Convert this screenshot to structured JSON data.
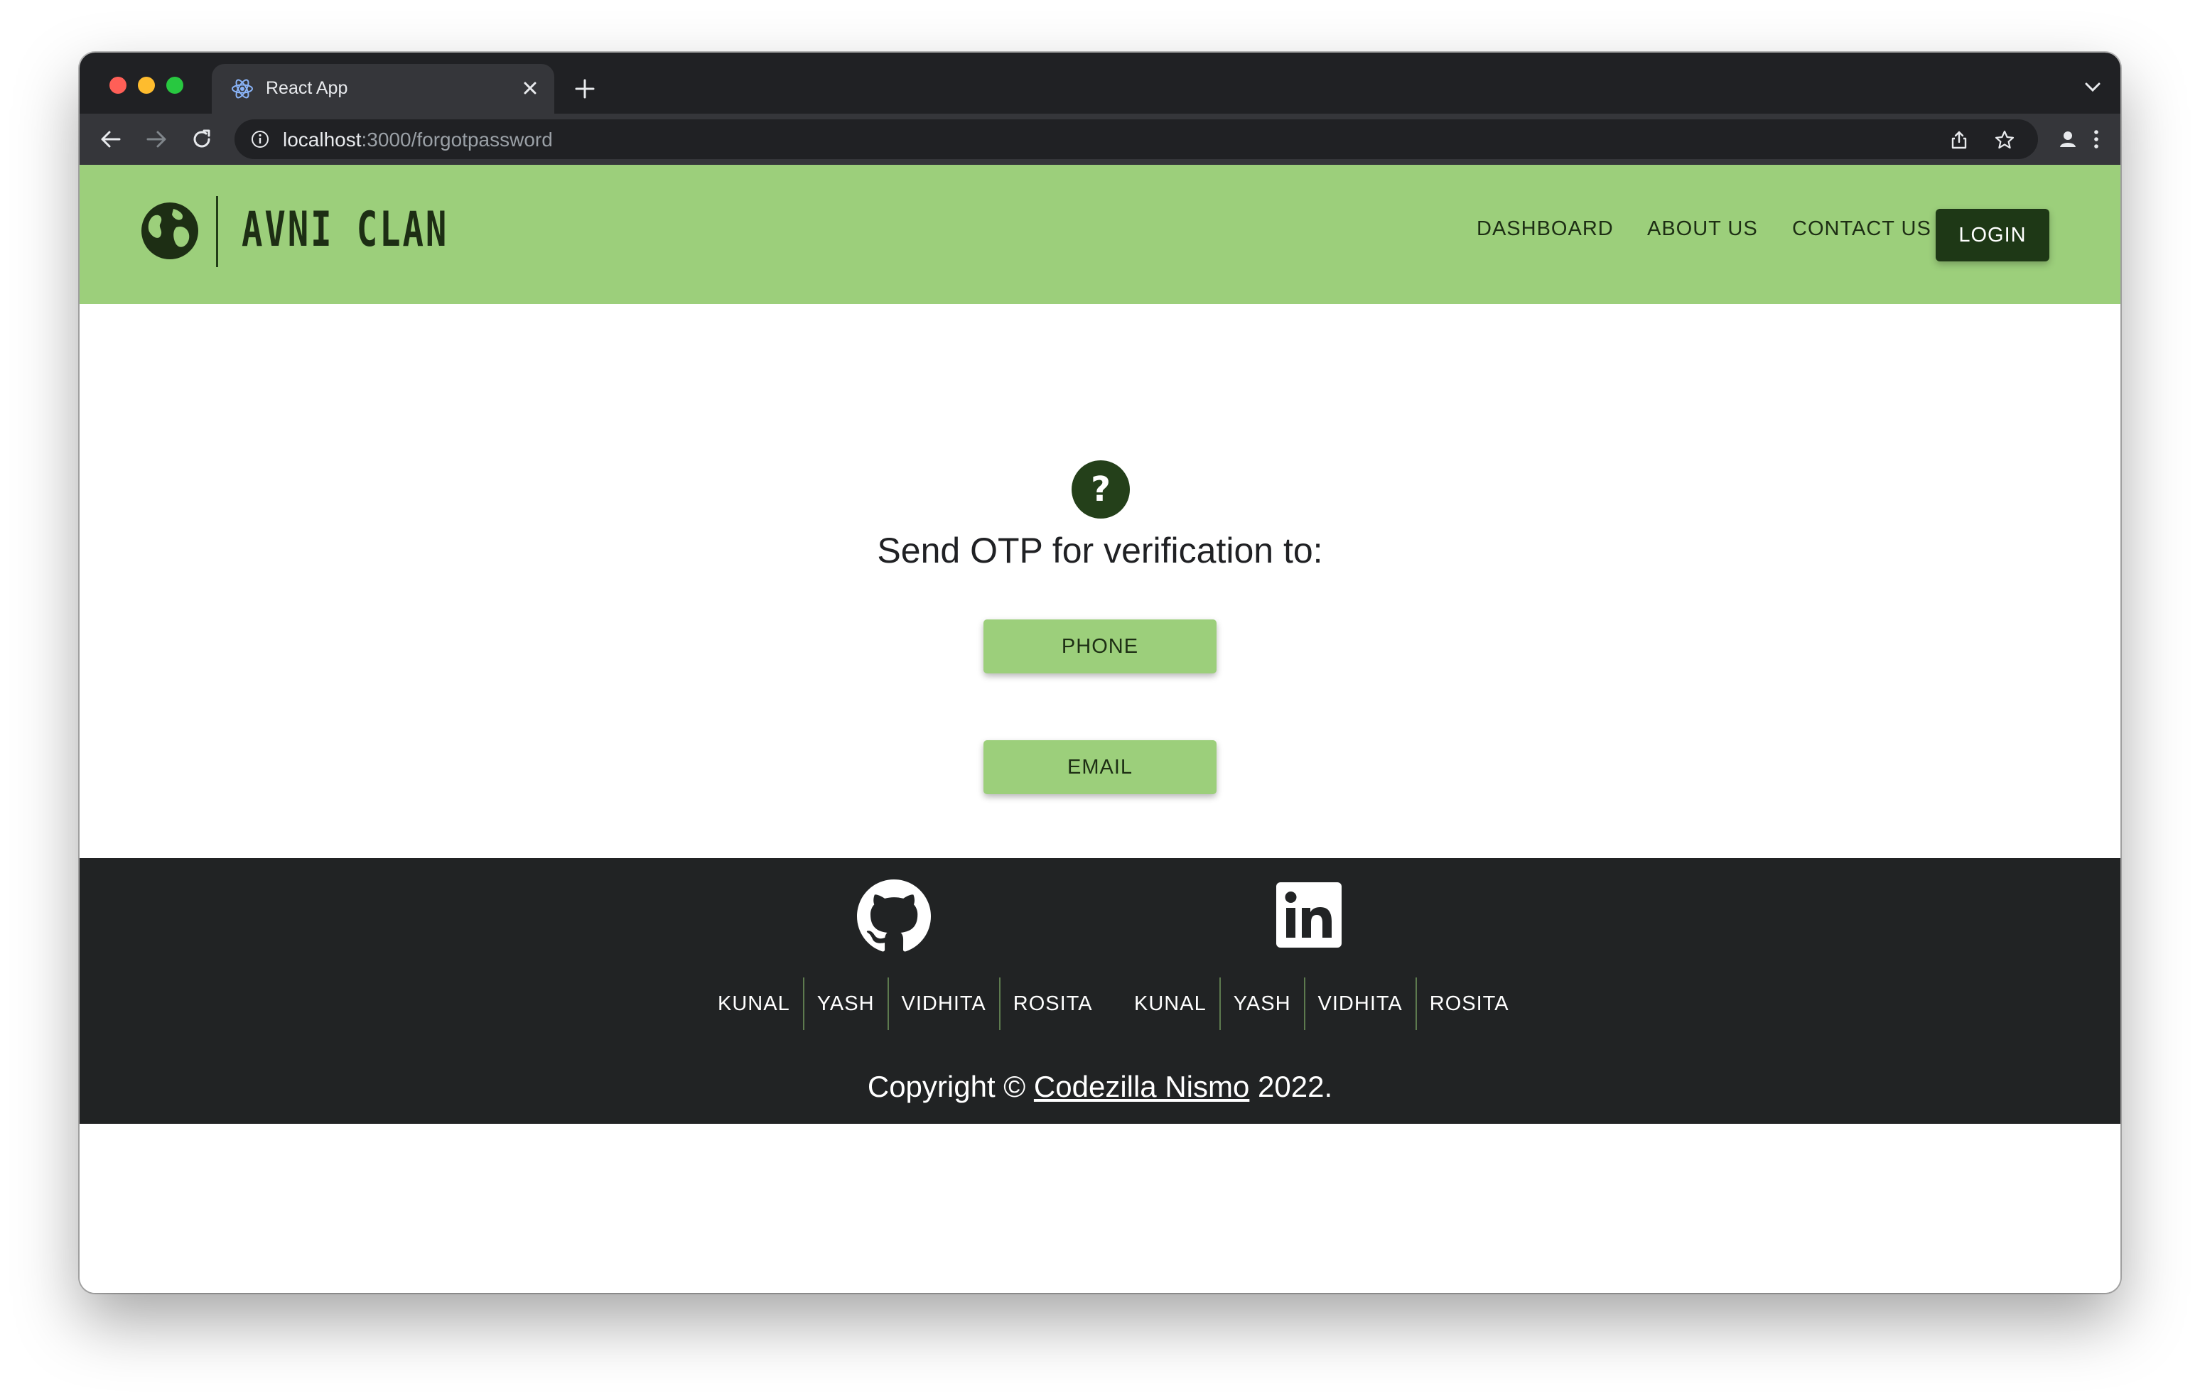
{
  "browser": {
    "tab_title": "React App",
    "url_host": "localhost",
    "url_path": ":3000/forgotpassword"
  },
  "site": {
    "brand": "AVNI CLAN",
    "nav": {
      "dashboard": "DASHBOARD",
      "about": "ABOUT US",
      "contact": "CONTACT US",
      "login": "LOGIN"
    }
  },
  "main": {
    "help_symbol": "?",
    "heading": "Send OTP for verification to:",
    "phone_label": "PHONE",
    "email_label": "EMAIL"
  },
  "footer": {
    "github_members": [
      "KUNAL",
      "YASH",
      "VIDHITA",
      "ROSITA"
    ],
    "linkedin_members": [
      "KUNAL",
      "YASH",
      "VIDHITA",
      "ROSITA"
    ],
    "copyright_prefix": "Copyright ©",
    "copyright_link": "Codezilla Nismo",
    "copyright_suffix": "2022."
  },
  "icons": {
    "tab_favicon": "react-icon",
    "logo": "globe-icon",
    "help": "question-icon",
    "github": "github-icon",
    "linkedin": "linkedin-icon"
  },
  "colors": {
    "header_green": "#9ccf7b",
    "dark_green": "#1e3816",
    "footer_dark": "#212324"
  }
}
